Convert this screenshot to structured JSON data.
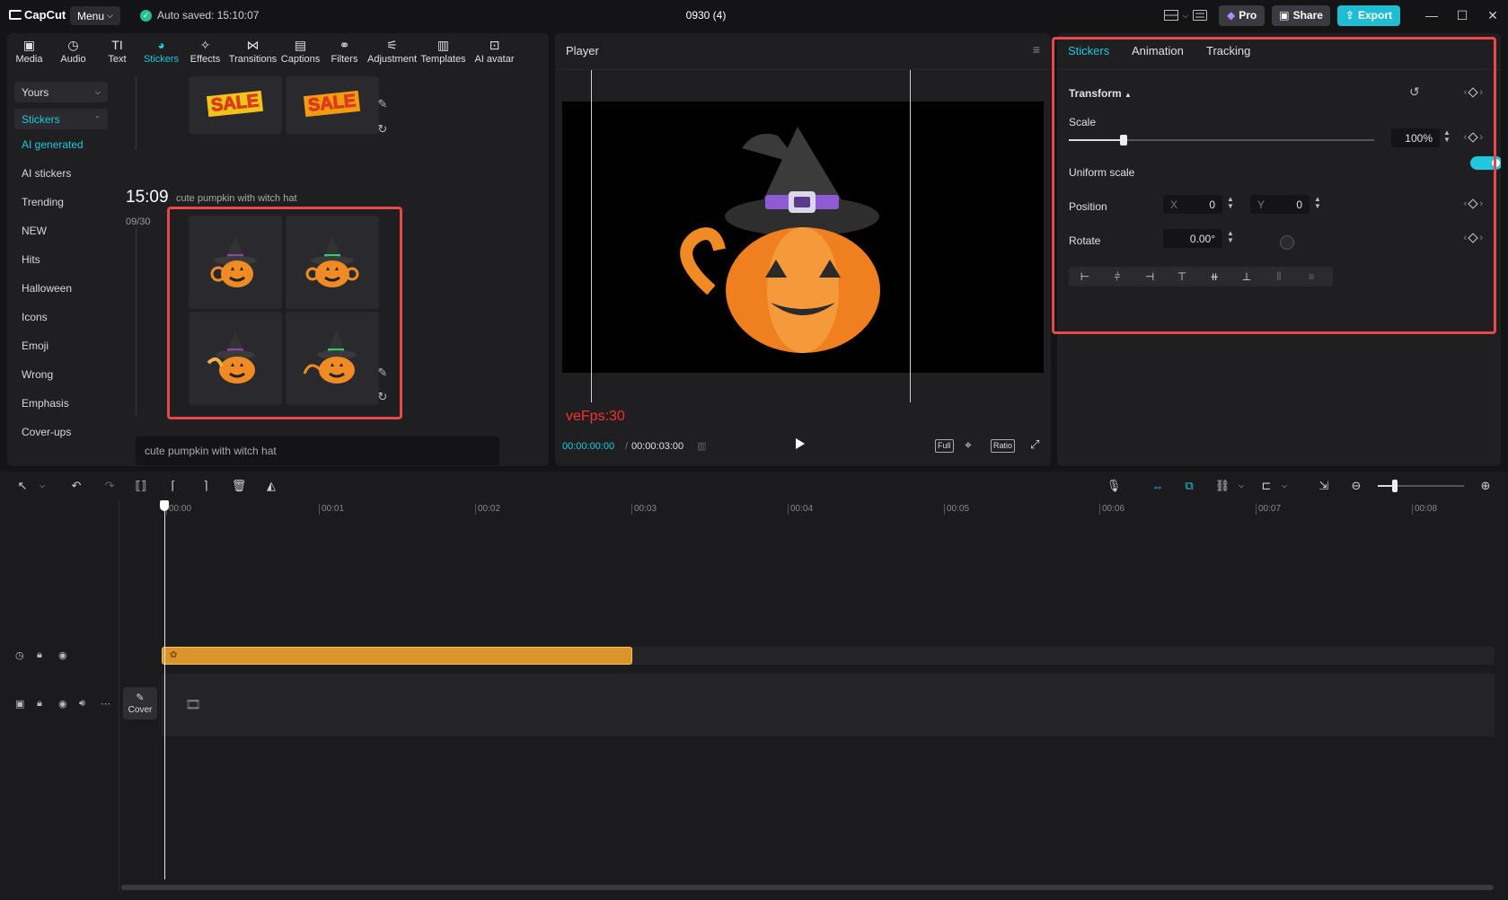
{
  "titlebar": {
    "logo": "CapCut",
    "menu_label": "Menu",
    "autosave": "Auto saved: 15:10:07",
    "project_title": "0930 (4)",
    "pro_label": "Pro",
    "share_label": "Share",
    "export_label": "Export"
  },
  "toolbar": {
    "items": [
      {
        "label": "Media",
        "icon": "media-icon"
      },
      {
        "label": "Audio",
        "icon": "audio-icon"
      },
      {
        "label": "Text",
        "icon": "text-icon"
      },
      {
        "label": "Stickers",
        "icon": "stickers-icon"
      },
      {
        "label": "Effects",
        "icon": "effects-icon"
      },
      {
        "label": "Transitions",
        "icon": "transitions-icon"
      },
      {
        "label": "Captions",
        "icon": "captions-icon"
      },
      {
        "label": "Filters",
        "icon": "filters-icon"
      },
      {
        "label": "Adjustment",
        "icon": "adjustment-icon"
      },
      {
        "label": "Templates",
        "icon": "templates-icon"
      },
      {
        "label": "AI avatar",
        "icon": "ai-avatar-icon"
      }
    ],
    "active": "Stickers"
  },
  "sidebar": {
    "yours_label": "Yours",
    "stickers_label": "Stickers",
    "items": [
      "AI generated",
      "AI stickers",
      "Trending",
      "NEW",
      "Hits",
      "Halloween",
      "Icons",
      "Emoji",
      "Wrong",
      "Emphasis",
      "Cover-ups"
    ],
    "active": "AI generated"
  },
  "stickers": {
    "sale_text": "SALE",
    "generation_time": "15:09",
    "generation_date": "09/30",
    "generation_prompt": "cute pumpkin with witch hat",
    "prompt_input_value": "cute pumpkin with witch hat"
  },
  "player": {
    "title": "Player",
    "fps_overlay": "veFps:30",
    "current_time": "00:00:00:00",
    "separator": "/",
    "duration": "00:00:03:00",
    "full_label": "Full",
    "ratio_label": "Ratio"
  },
  "properties": {
    "tabs": [
      "Stickers",
      "Animation",
      "Tracking"
    ],
    "active_tab": "Stickers",
    "transform_label": "Transform",
    "scale_label": "Scale",
    "scale_value": "100%",
    "scale_fraction": 0.18,
    "uniform_scale_label": "Uniform scale",
    "uniform_scale_on": true,
    "position_label": "Position",
    "x_label": "X",
    "x_value": "0",
    "y_label": "Y",
    "y_value": "0",
    "rotate_label": "Rotate",
    "rotate_value": "0.00°"
  },
  "timeline": {
    "ruler_ticks": [
      "00:00",
      "00:01",
      "00:02",
      "00:03",
      "00:04",
      "00:05",
      "00:06",
      "00:07",
      "00:08"
    ],
    "cover_label": "Cover",
    "zoom_fraction": 0.2
  },
  "colors": {
    "accent": "#1fc8de",
    "highlight_outline": "#e8484a",
    "sticker_clip": "#d9952b",
    "fps_text": "#ff2d2d"
  }
}
